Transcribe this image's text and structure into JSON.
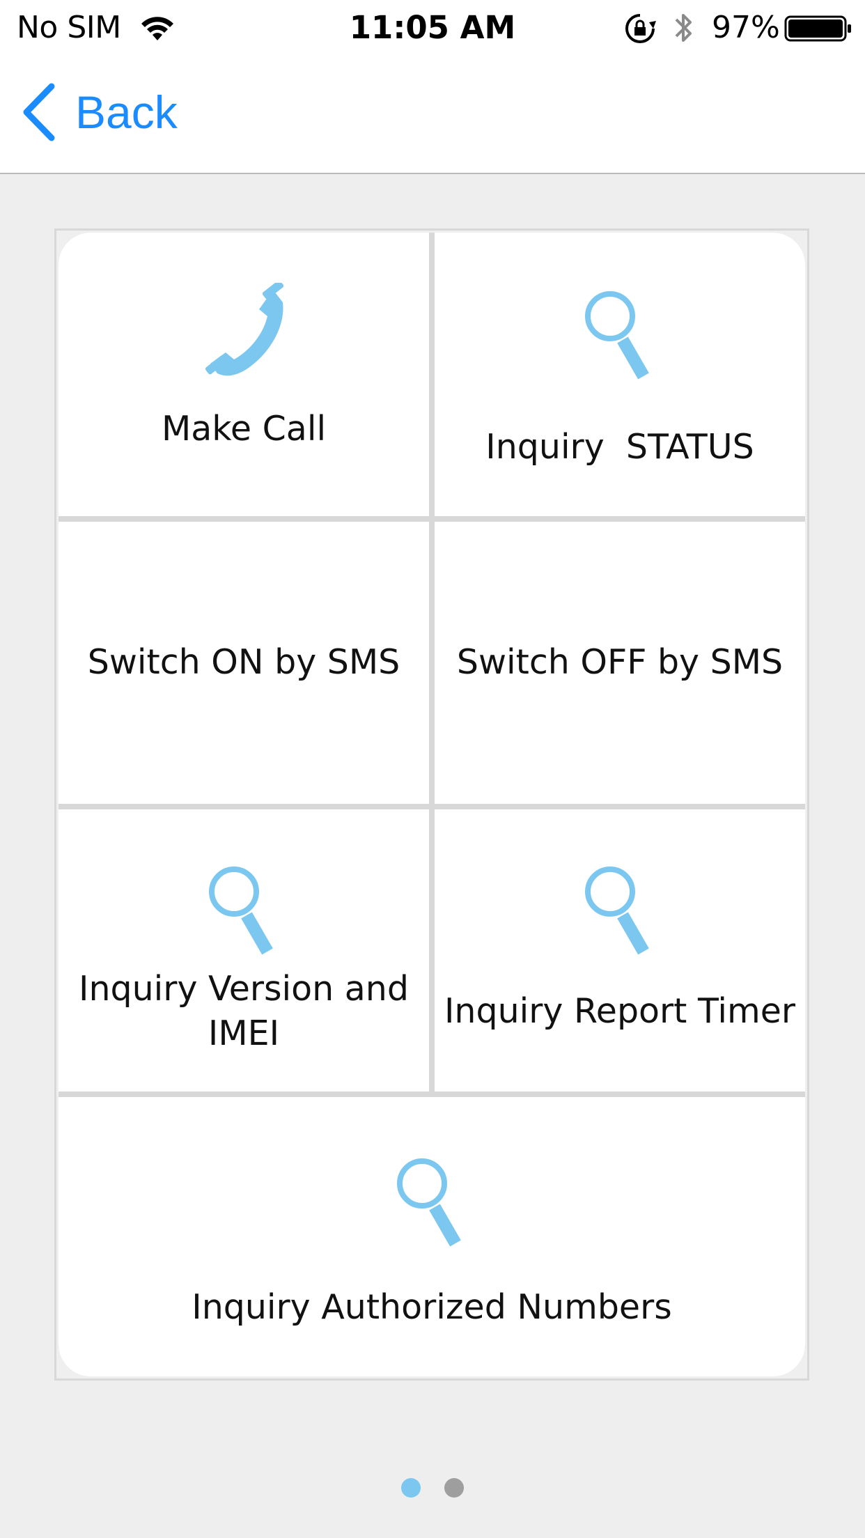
{
  "status_bar": {
    "carrier": "No SIM",
    "time": "11:05 AM",
    "battery_percent": "97%"
  },
  "nav": {
    "back_label": "Back"
  },
  "grid": {
    "tiles": [
      {
        "label": "Make Call",
        "icon": "phone-icon"
      },
      {
        "label": "Inquiry  STATUS",
        "icon": "search-icon"
      },
      {
        "label": "Switch ON by SMS",
        "icon": ""
      },
      {
        "label": "Switch OFF by SMS",
        "icon": ""
      },
      {
        "label_line1": "Inquiry Version and",
        "label_line2": "IMEI",
        "icon": "search-icon"
      },
      {
        "label": "Inquiry Report Timer",
        "icon": "search-icon"
      },
      {
        "label": "Inquiry Authorized Numbers",
        "icon": "search-icon"
      }
    ]
  },
  "pager": {
    "pages": 2,
    "current": 1
  },
  "colors": {
    "accent": "#1a8cff",
    "icon": "#7cc7f0",
    "background": "#eeeeee",
    "tile": "#ffffff",
    "divider": "#d8d8d8"
  }
}
